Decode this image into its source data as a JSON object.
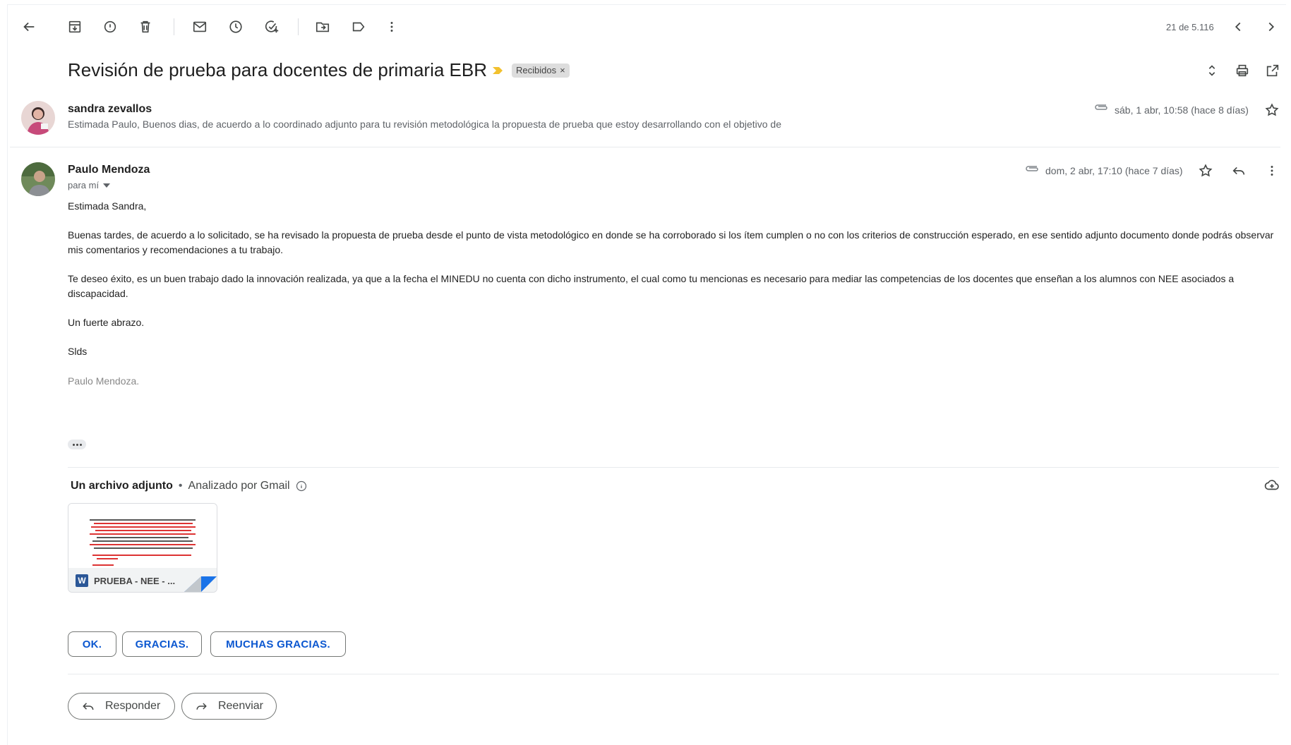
{
  "toolbar": {
    "counter": "21 de 5.116"
  },
  "subject": {
    "title": "Revisión de prueba para docentes de primaria EBR",
    "label": "Recibidos",
    "label_close": "×"
  },
  "messages": [
    {
      "sender": "sandra zevallos",
      "date": "sáb, 1 abr, 10:58 (hace 8 días)",
      "snippet": "Estimada Paulo, Buenos dias, de acuerdo a lo coordinado adjunto para tu revisión metodológica la propuesta de prueba que estoy desarrollando con el objetivo de"
    },
    {
      "sender": "Paulo Mendoza",
      "recipient": "para mí",
      "date": "dom, 2 abr, 17:10 (hace 7 días)",
      "greeting": "Estimada Sandra,",
      "para1": "Buenas tardes, de acuerdo a lo solicitado, se ha revisado la propuesta de prueba desde el punto de vista metodológico en donde se ha corroborado si los ítem cumplen o no con los criterios de construcción esperado, en ese sentido adjunto documento donde podrás observar mis comentarios y recomendaciones a tu trabajo.",
      "para2": "Te deseo éxito, es un buen trabajo dado la innovación realizada, ya que a la fecha el MINEDU no cuenta con dicho instrumento, el cual como tu mencionas es necesario para mediar las competencias de los docentes que enseñan a los alumnos con NEE asociados a discapacidad.",
      "closing": "Un fuerte abrazo.",
      "regards": "Slds",
      "signature": "Paulo Mendoza."
    }
  ],
  "attachments": {
    "title": "Un archivo adjunto",
    "separator": "•",
    "scanned": "Analizado por Gmail",
    "file_name": "PRUEBA - NEE - ...",
    "file_type": "W"
  },
  "smart_replies": [
    "OK.",
    "GRACIAS.",
    "MUCHAS GRACIAS."
  ],
  "actions": {
    "reply": "Responder",
    "forward": "Reenviar"
  }
}
